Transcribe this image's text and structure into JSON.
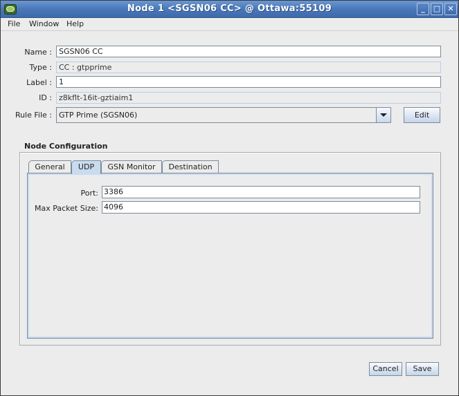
{
  "window": {
    "title": "Node 1 <SGSN06 CC> @ Ottawa:55109",
    "controls": {
      "minimize": "_",
      "maximize": "□",
      "close": "✕"
    }
  },
  "menubar": {
    "items": [
      "File",
      "Window",
      "Help"
    ]
  },
  "form": {
    "name": {
      "label": "Name :",
      "value": "SGSN06 CC"
    },
    "type": {
      "label": "Type :",
      "value": "CC : gtpprime"
    },
    "label": {
      "label": "Label :",
      "value": "1"
    },
    "id": {
      "label": "ID :",
      "value": "z8kflt-16it-gztiaim1"
    },
    "rule_file": {
      "label": "Rule File :",
      "value": "GTP Prime (SGSN06)"
    },
    "edit_button": "Edit"
  },
  "node_configuration": {
    "title": "Node Configuration",
    "tabs": [
      {
        "label": "General",
        "active": false
      },
      {
        "label": "UDP",
        "active": true
      },
      {
        "label": "GSN Monitor",
        "active": false
      },
      {
        "label": "Destination",
        "active": false
      }
    ],
    "udp": {
      "port": {
        "label": "Port:",
        "value": "3386"
      },
      "max_packet_size": {
        "label": "Max Packet Size:",
        "value": "4096"
      }
    }
  },
  "footer": {
    "cancel": "Cancel",
    "save": "Save"
  }
}
